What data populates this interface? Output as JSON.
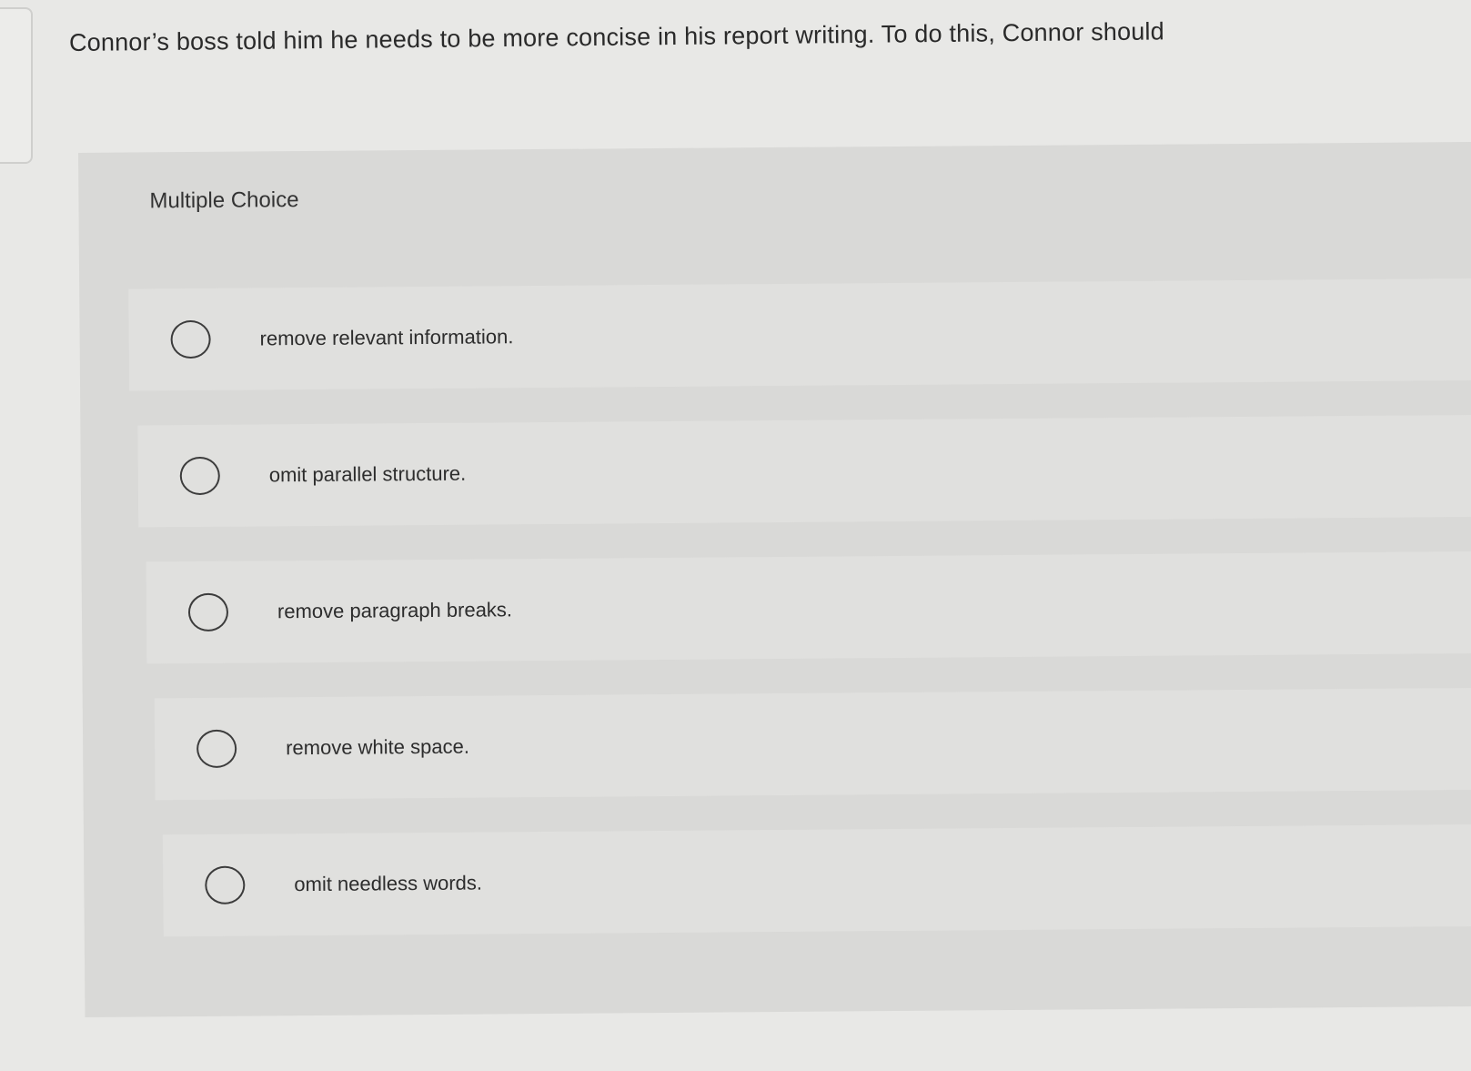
{
  "question": {
    "text": "Connor’s boss told him he needs to be more concise in his report writing. To do this, Connor should"
  },
  "question_type": "Multiple Choice",
  "options": [
    {
      "label": "remove relevant information."
    },
    {
      "label": "omit parallel structure."
    },
    {
      "label": "remove paragraph breaks."
    },
    {
      "label": "remove white space."
    },
    {
      "label": "omit needless words."
    }
  ],
  "colors": {
    "page_background": "#e8e8e6",
    "panel_background": "#d9d9d7",
    "option_background": "#e0e0de",
    "text": "#2b2b2b",
    "radio_border": "#3c3c3c"
  }
}
